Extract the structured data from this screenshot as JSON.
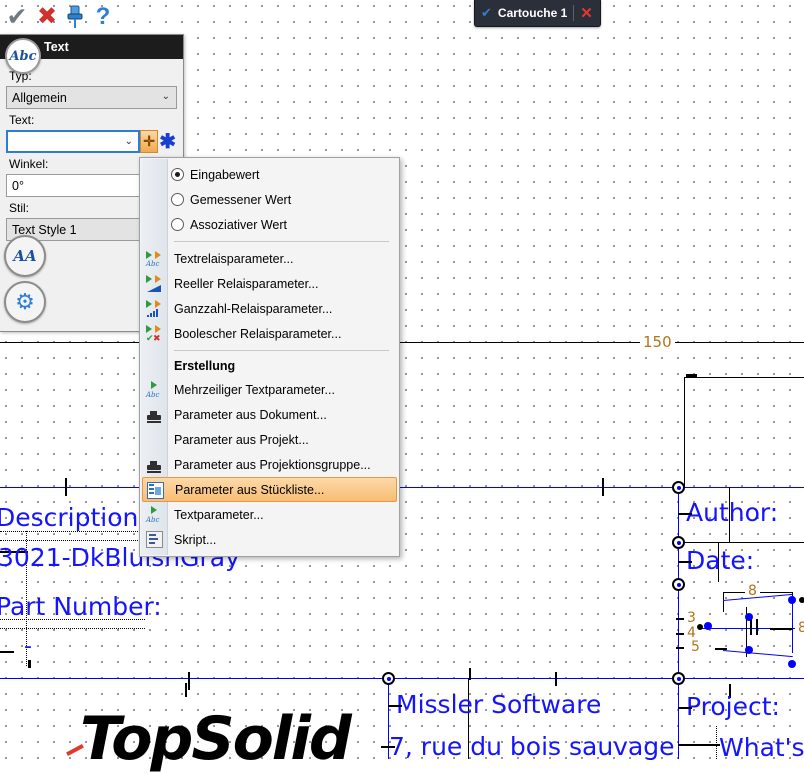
{
  "toolbar": {
    "items": [
      {
        "name": "validate-icon",
        "glyph": "✔",
        "color": "#6e7a86"
      },
      {
        "name": "cancel-icon",
        "glyph": "✖",
        "color": "#d0312d"
      },
      {
        "name": "pin-icon",
        "glyph": "📌",
        "color": "#2f7fd1"
      },
      {
        "name": "help-icon",
        "glyph": "?",
        "color": "#2f7fd1"
      }
    ]
  },
  "document_tab": {
    "check_glyph": "✔",
    "title": "Cartouche 1",
    "close_glyph": "✕"
  },
  "panel": {
    "badge": "Abc",
    "title": "Text",
    "type_label": "Typ:",
    "type_value": "Allgemein",
    "text_label": "Text:",
    "text_value": "",
    "text_placeholder": "",
    "add_button": "✛",
    "star_button": "✱",
    "angle_label": "Winkel:",
    "angle_value": "0°",
    "style_label": "Stil:",
    "style_value": "Text Style 1",
    "font_button": "AA",
    "settings_button": "⚙",
    "dropdown_arrow": "⌄"
  },
  "context_menu": {
    "radio_options": [
      {
        "label": "Eingabewert",
        "selected": true
      },
      {
        "label": "Gemessener Wert",
        "selected": false
      },
      {
        "label": "Assoziativer Wert",
        "selected": false
      }
    ],
    "param_items": [
      {
        "label": "Textrelaisparameter...",
        "icon": "text-relay-param-icon"
      },
      {
        "label": "Reeller Relaisparameter...",
        "icon": "real-relay-param-icon"
      },
      {
        "label": "Ganzzahl-Relaisparameter...",
        "icon": "integer-relay-param-icon"
      },
      {
        "label": "Boolescher Relaisparameter...",
        "icon": "boolean-relay-param-icon"
      }
    ],
    "section_header": "Erstellung",
    "creation_items": [
      {
        "label": "Mehrzeiliger Textparameter...",
        "icon": "multiline-text-param-icon",
        "highlighted": false
      },
      {
        "label": "Parameter aus Dokument...",
        "icon": "document-param-icon",
        "highlighted": false
      },
      {
        "label": "Parameter aus Projekt...",
        "icon": "none",
        "highlighted": false
      },
      {
        "label": "Parameter aus Projektionsgruppe...",
        "icon": "projection-group-param-icon",
        "highlighted": false
      },
      {
        "label": "Parameter aus Stückliste...",
        "icon": "bom-param-icon",
        "highlighted": true
      },
      {
        "label": "Textparameter...",
        "icon": "text-param-icon",
        "highlighted": false
      },
      {
        "label": "Skript...",
        "icon": "script-icon",
        "highlighted": false
      }
    ]
  },
  "drawing": {
    "dimension_top": "150",
    "dimension_width": "8",
    "dimension_right": "8",
    "leader_labels": [
      "3",
      "4",
      "5"
    ],
    "texts": {
      "description_label": "Description:",
      "description_value": "3021-DkBluishGray",
      "part_number_label": "Part Number:",
      "part_number_value": "-",
      "company": "Missler Software",
      "address": "7, rue du bois sauvage",
      "author_label": "Author:",
      "date_label": "Date:",
      "project_label": "Project:",
      "project_value": "What's",
      "logo": "TopSolid"
    },
    "colors": {
      "geometry": "#1414ff",
      "dimension": "#b2741a",
      "frame": "#000000"
    }
  }
}
